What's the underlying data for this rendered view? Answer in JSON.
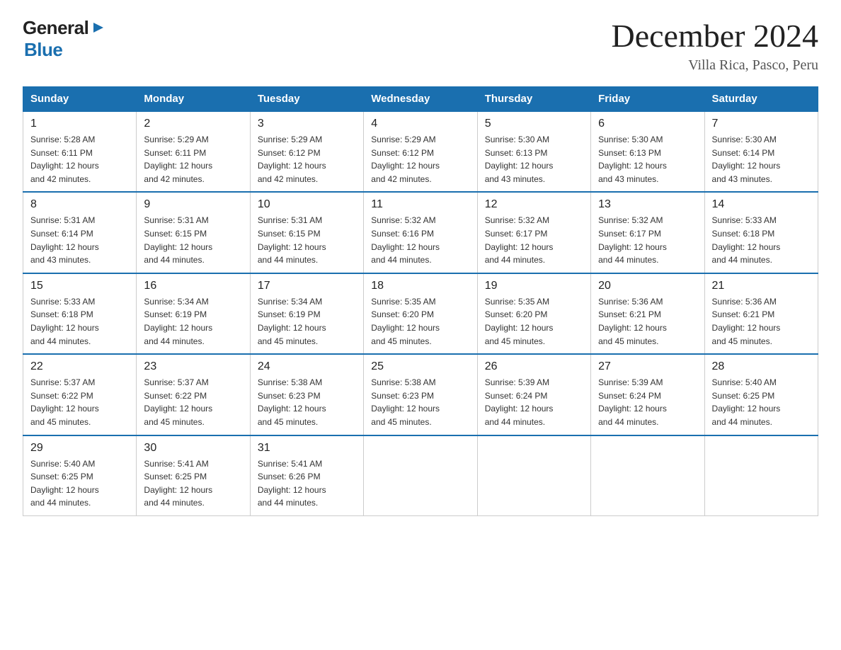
{
  "header": {
    "title": "December 2024",
    "subtitle": "Villa Rica, Pasco, Peru",
    "logo_general": "General",
    "logo_blue": "Blue"
  },
  "columns": [
    "Sunday",
    "Monday",
    "Tuesday",
    "Wednesday",
    "Thursday",
    "Friday",
    "Saturday"
  ],
  "weeks": [
    [
      {
        "num": "1",
        "sunrise": "5:28 AM",
        "sunset": "6:11 PM",
        "daylight": "12 hours and 42 minutes."
      },
      {
        "num": "2",
        "sunrise": "5:29 AM",
        "sunset": "6:11 PM",
        "daylight": "12 hours and 42 minutes."
      },
      {
        "num": "3",
        "sunrise": "5:29 AM",
        "sunset": "6:12 PM",
        "daylight": "12 hours and 42 minutes."
      },
      {
        "num": "4",
        "sunrise": "5:29 AM",
        "sunset": "6:12 PM",
        "daylight": "12 hours and 42 minutes."
      },
      {
        "num": "5",
        "sunrise": "5:30 AM",
        "sunset": "6:13 PM",
        "daylight": "12 hours and 43 minutes."
      },
      {
        "num": "6",
        "sunrise": "5:30 AM",
        "sunset": "6:13 PM",
        "daylight": "12 hours and 43 minutes."
      },
      {
        "num": "7",
        "sunrise": "5:30 AM",
        "sunset": "6:14 PM",
        "daylight": "12 hours and 43 minutes."
      }
    ],
    [
      {
        "num": "8",
        "sunrise": "5:31 AM",
        "sunset": "6:14 PM",
        "daylight": "12 hours and 43 minutes."
      },
      {
        "num": "9",
        "sunrise": "5:31 AM",
        "sunset": "6:15 PM",
        "daylight": "12 hours and 44 minutes."
      },
      {
        "num": "10",
        "sunrise": "5:31 AM",
        "sunset": "6:15 PM",
        "daylight": "12 hours and 44 minutes."
      },
      {
        "num": "11",
        "sunrise": "5:32 AM",
        "sunset": "6:16 PM",
        "daylight": "12 hours and 44 minutes."
      },
      {
        "num": "12",
        "sunrise": "5:32 AM",
        "sunset": "6:17 PM",
        "daylight": "12 hours and 44 minutes."
      },
      {
        "num": "13",
        "sunrise": "5:32 AM",
        "sunset": "6:17 PM",
        "daylight": "12 hours and 44 minutes."
      },
      {
        "num": "14",
        "sunrise": "5:33 AM",
        "sunset": "6:18 PM",
        "daylight": "12 hours and 44 minutes."
      }
    ],
    [
      {
        "num": "15",
        "sunrise": "5:33 AM",
        "sunset": "6:18 PM",
        "daylight": "12 hours and 44 minutes."
      },
      {
        "num": "16",
        "sunrise": "5:34 AM",
        "sunset": "6:19 PM",
        "daylight": "12 hours and 44 minutes."
      },
      {
        "num": "17",
        "sunrise": "5:34 AM",
        "sunset": "6:19 PM",
        "daylight": "12 hours and 45 minutes."
      },
      {
        "num": "18",
        "sunrise": "5:35 AM",
        "sunset": "6:20 PM",
        "daylight": "12 hours and 45 minutes."
      },
      {
        "num": "19",
        "sunrise": "5:35 AM",
        "sunset": "6:20 PM",
        "daylight": "12 hours and 45 minutes."
      },
      {
        "num": "20",
        "sunrise": "5:36 AM",
        "sunset": "6:21 PM",
        "daylight": "12 hours and 45 minutes."
      },
      {
        "num": "21",
        "sunrise": "5:36 AM",
        "sunset": "6:21 PM",
        "daylight": "12 hours and 45 minutes."
      }
    ],
    [
      {
        "num": "22",
        "sunrise": "5:37 AM",
        "sunset": "6:22 PM",
        "daylight": "12 hours and 45 minutes."
      },
      {
        "num": "23",
        "sunrise": "5:37 AM",
        "sunset": "6:22 PM",
        "daylight": "12 hours and 45 minutes."
      },
      {
        "num": "24",
        "sunrise": "5:38 AM",
        "sunset": "6:23 PM",
        "daylight": "12 hours and 45 minutes."
      },
      {
        "num": "25",
        "sunrise": "5:38 AM",
        "sunset": "6:23 PM",
        "daylight": "12 hours and 45 minutes."
      },
      {
        "num": "26",
        "sunrise": "5:39 AM",
        "sunset": "6:24 PM",
        "daylight": "12 hours and 44 minutes."
      },
      {
        "num": "27",
        "sunrise": "5:39 AM",
        "sunset": "6:24 PM",
        "daylight": "12 hours and 44 minutes."
      },
      {
        "num": "28",
        "sunrise": "5:40 AM",
        "sunset": "6:25 PM",
        "daylight": "12 hours and 44 minutes."
      }
    ],
    [
      {
        "num": "29",
        "sunrise": "5:40 AM",
        "sunset": "6:25 PM",
        "daylight": "12 hours and 44 minutes."
      },
      {
        "num": "30",
        "sunrise": "5:41 AM",
        "sunset": "6:25 PM",
        "daylight": "12 hours and 44 minutes."
      },
      {
        "num": "31",
        "sunrise": "5:41 AM",
        "sunset": "6:26 PM",
        "daylight": "12 hours and 44 minutes."
      },
      null,
      null,
      null,
      null
    ]
  ],
  "sunrise_label": "Sunrise:",
  "sunset_label": "Sunset:",
  "daylight_label": "Daylight:"
}
